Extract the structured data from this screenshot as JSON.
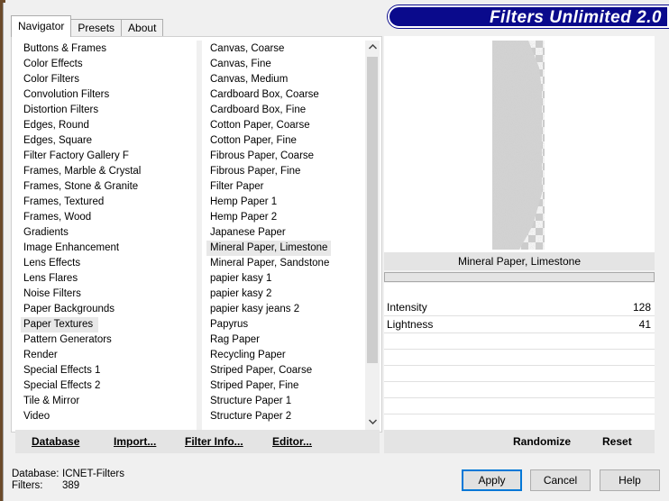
{
  "banner_title": "Filters Unlimited 2.0",
  "tabs": [
    {
      "label": "Navigator",
      "active": true
    },
    {
      "label": "Presets",
      "active": false
    },
    {
      "label": "About",
      "active": false
    }
  ],
  "categories": [
    "Buttons & Frames",
    "Color Effects",
    "Color Filters",
    "Convolution Filters",
    "Distortion Filters",
    "Edges, Round",
    "Edges, Square",
    "Filter Factory Gallery F",
    "Frames, Marble & Crystal",
    "Frames, Stone & Granite",
    "Frames, Textured",
    "Frames, Wood",
    "Gradients",
    "Image Enhancement",
    "Lens Effects",
    "Lens Flares",
    "Noise Filters",
    "Paper Backgrounds",
    "Paper Textures",
    "Pattern Generators",
    "Render",
    "Special Effects 1",
    "Special Effects 2",
    "Tile & Mirror",
    "Video"
  ],
  "selected_category": "Paper Textures",
  "filters": [
    "Canvas, Coarse",
    "Canvas, Fine",
    "Canvas, Medium",
    "Cardboard Box, Coarse",
    "Cardboard Box, Fine",
    "Cotton Paper, Coarse",
    "Cotton Paper, Fine",
    "Fibrous Paper, Coarse",
    "Fibrous Paper, Fine",
    "Filter Paper",
    "Hemp Paper 1",
    "Hemp Paper 2",
    "Japanese Paper",
    "Mineral Paper, Limestone",
    "Mineral Paper, Sandstone",
    "papier kasy 1",
    "papier kasy 2",
    "papier kasy jeans 2",
    "Papyrus",
    "Rag Paper",
    "Recycling Paper",
    "Striped Paper, Coarse",
    "Striped Paper, Fine",
    "Structure Paper 1",
    "Structure Paper 2"
  ],
  "selected_filter": "Mineral Paper, Limestone",
  "commands": {
    "database": "Database",
    "import": "Import...",
    "filter_info": "Filter Info...",
    "editor": "Editor..."
  },
  "preview": {
    "filter_name": "Mineral Paper, Limestone"
  },
  "params": [
    {
      "label": "Intensity",
      "value": "128"
    },
    {
      "label": "Lightness",
      "value": "41"
    }
  ],
  "right_commands": {
    "randomize": "Randomize",
    "reset": "Reset"
  },
  "status": {
    "database_label": "Database:",
    "database_value": "ICNET-Filters",
    "filters_label": "Filters:",
    "filters_value": "389"
  },
  "dialog_buttons": {
    "apply": "Apply",
    "cancel": "Cancel",
    "help": "Help"
  },
  "colors": {
    "banner_bg": "#0a0a8c",
    "default_button_border": "#0078d7",
    "selection_bg": "#e8e8e8"
  }
}
